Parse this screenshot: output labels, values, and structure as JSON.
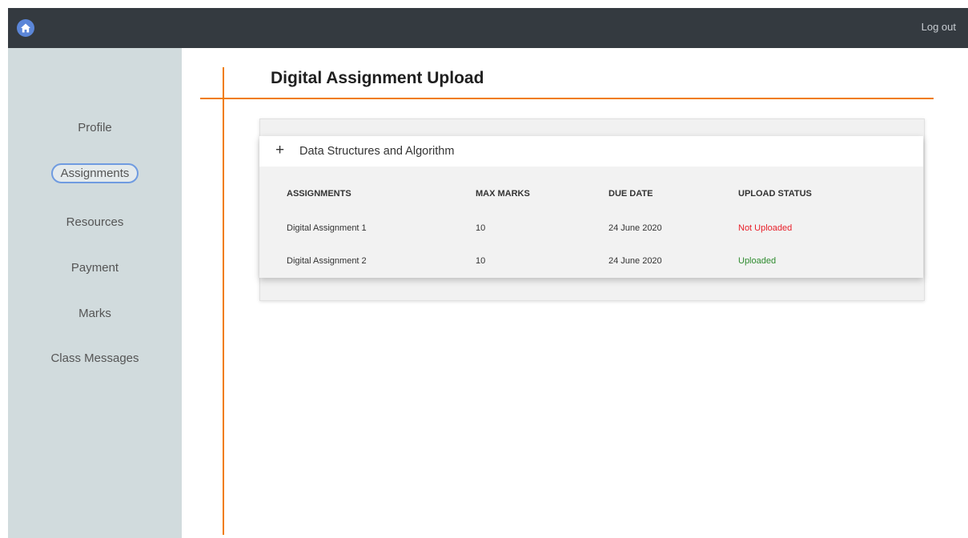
{
  "header": {
    "logout_label": "Log out"
  },
  "sidebar": {
    "items": [
      {
        "label": "Profile",
        "active": false
      },
      {
        "label": "Assignments",
        "active": true
      },
      {
        "label": "Resources",
        "active": false
      },
      {
        "label": "Payment",
        "active": false
      },
      {
        "label": "Marks",
        "active": false
      },
      {
        "label": "Class Messages",
        "active": false
      }
    ]
  },
  "main": {
    "title": "Digital Assignment Upload",
    "course": {
      "toggle_symbol": "+",
      "name": "Data Structures and Algorithm"
    },
    "table": {
      "columns": [
        "ASSIGNMENTS",
        "MAX MARKS",
        "DUE DATE",
        "UPLOAD STATUS"
      ],
      "rows": [
        {
          "assignment": "Digital Assignment 1",
          "max_marks": "10",
          "due_date": "24 June 2020",
          "status": "Not Uploaded"
        },
        {
          "assignment": "Digital Assignment 2",
          "max_marks": "10",
          "due_date": "24 June 2020",
          "status": "Uploaded"
        }
      ]
    }
  },
  "colors": {
    "topbar": "#343a40",
    "sidebar": "#d1dbdd",
    "accent": "#f07c00",
    "active_outline": "#6f9be0",
    "status_not_uploaded": "#e8202a",
    "status_uploaded": "#2e8b2e"
  },
  "icons": {
    "home": "home-icon",
    "expand": "plus-icon"
  }
}
